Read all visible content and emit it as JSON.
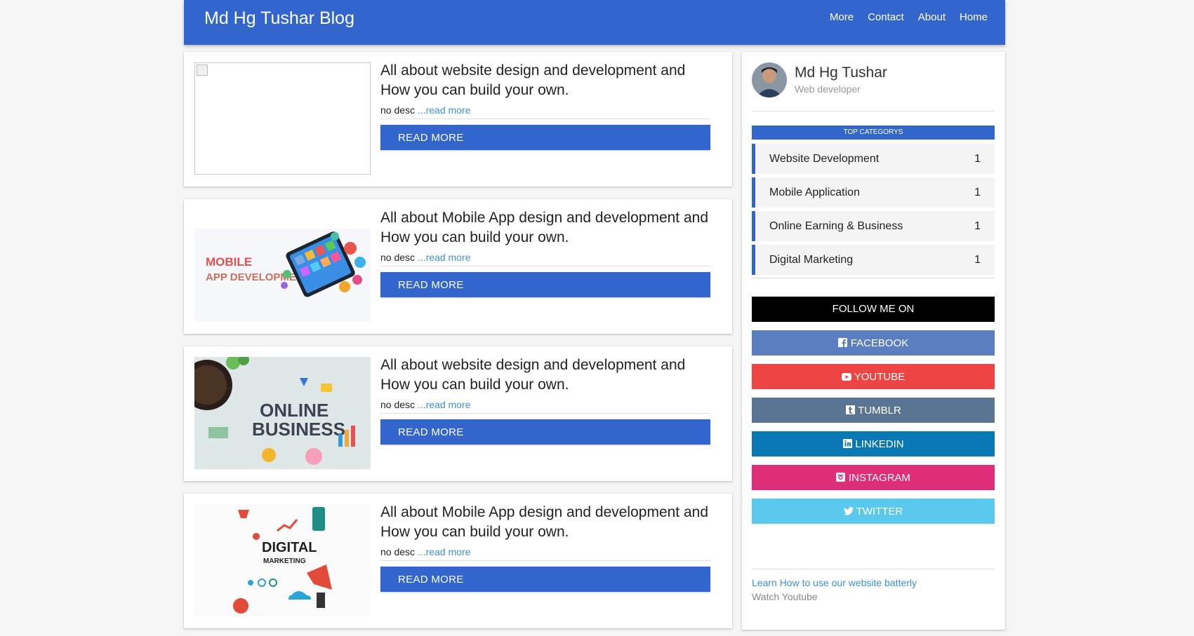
{
  "header": {
    "brand": "Md Hg Tushar Blog",
    "nav": [
      "More",
      "Contact",
      "About",
      "Home"
    ]
  },
  "posts": [
    {
      "title": "All about website design and development and How you can build your own.",
      "desc": "no desc",
      "read_link": "...read more",
      "button": "READ MORE",
      "image": "broken-image"
    },
    {
      "title": "All about Mobile App design and development and How you can build your own.",
      "desc": "no desc",
      "read_link": "...read more",
      "button": "READ MORE",
      "image": "mobile-app-development",
      "image_text": [
        "MOBILE",
        "APP DEVELOPMENT"
      ]
    },
    {
      "title": "All about website design and development and How you can build your own.",
      "desc": "no desc",
      "read_link": "...read more",
      "button": "READ MORE",
      "image": "online-business",
      "image_text": [
        "ONLINE",
        "BUSINESS"
      ]
    },
    {
      "title": "All about Mobile App design and development and How you can build your own.",
      "desc": "no desc",
      "read_link": "...read more",
      "button": "READ MORE",
      "image": "digital-marketing",
      "image_text": [
        "DIGITAL",
        "MARKETING"
      ]
    }
  ],
  "sidebar": {
    "profile": {
      "name": "Md Hg Tushar",
      "role": "Web developer"
    },
    "categories_title": "TOP CATEGORYS",
    "categories": [
      {
        "label": "Website Development",
        "count": "1"
      },
      {
        "label": "Mobile Application",
        "count": "1"
      },
      {
        "label": "Online Earning & Business",
        "count": "1"
      },
      {
        "label": "Digital Marketing",
        "count": "1"
      }
    ],
    "follow_title": "FOLLOW ME ON",
    "social": [
      {
        "label": "FACEBOOK",
        "color": "#5a7ebf",
        "icon": "facebook-icon"
      },
      {
        "label": "YOUTUBE",
        "color": "#ee4444",
        "icon": "youtube-icon"
      },
      {
        "label": "TUMBLR",
        "color": "#5a7592",
        "icon": "tumblr-icon"
      },
      {
        "label": "LINKEDIN",
        "color": "#0a78b5",
        "icon": "linkedin-icon"
      },
      {
        "label": "INSTAGRAM",
        "color": "#df2d78",
        "icon": "instagram-icon"
      },
      {
        "label": "TWITTER",
        "color": "#5bc8ee",
        "icon": "twitter-icon"
      }
    ],
    "learn_link": "Learn How to use our website batterly",
    "watch_text": "Watch Youtube"
  },
  "colors": {
    "primary": "#3366cc",
    "link": "#3d8fd8",
    "background": "#f5f5f5"
  }
}
